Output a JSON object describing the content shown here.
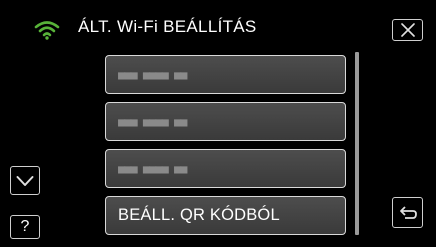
{
  "header": {
    "title": "ÁLT. Wi-Fi BEÁLLÍTÁS",
    "wifi_icon": "wifi-icon",
    "close_icon": "close-icon",
    "wifi_color": "#58b339"
  },
  "list": {
    "items": [
      {
        "label": "■■■ ■■■■ ■■"
      },
      {
        "label": "■■■ ■■■■ ■■"
      },
      {
        "label": "■■■ ■■■■ ■■"
      },
      {
        "label": "BEÁLL. QR KÓDBÓL"
      }
    ]
  },
  "controls": {
    "down_icon": "chevron-down-icon",
    "help_label": "?",
    "back_icon": "back-arrow-icon"
  }
}
